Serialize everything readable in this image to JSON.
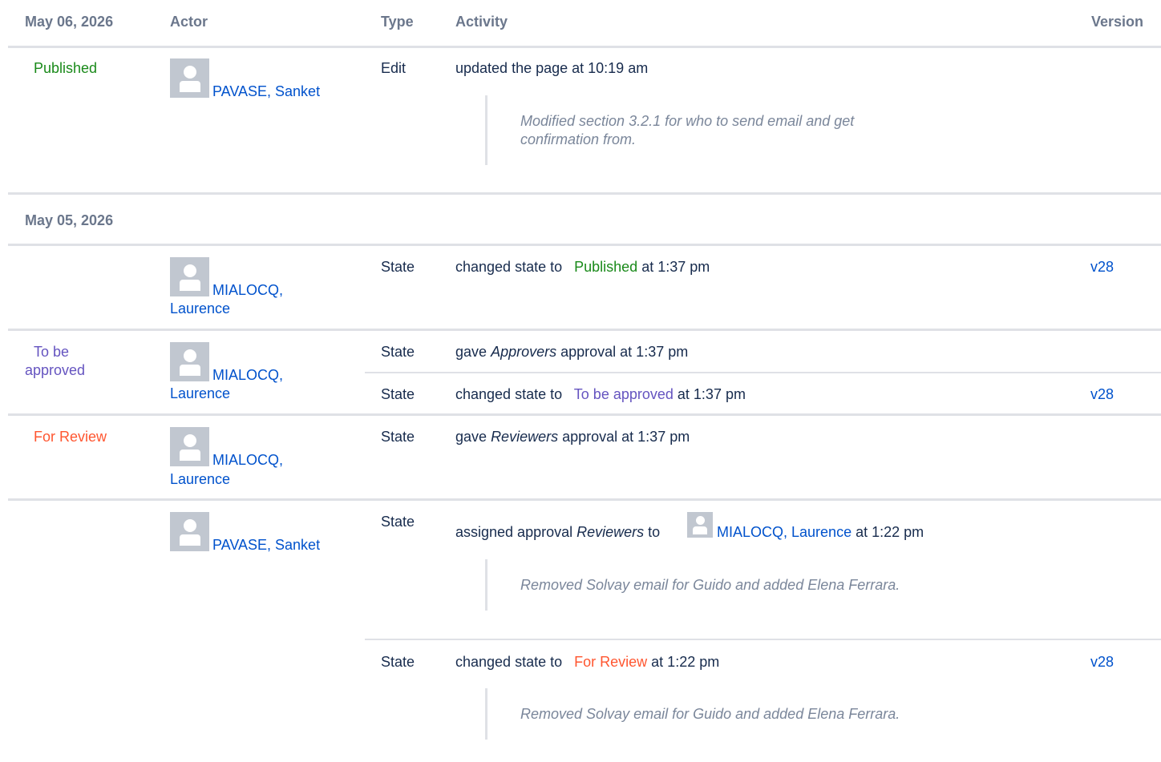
{
  "header": {
    "date": "May 06, 2026",
    "actor": "Actor",
    "type": "Type",
    "activity": "Activity",
    "version": "Version"
  },
  "second_date": "May 05, 2026",
  "colors": {
    "published": "#1a8a1a",
    "to_be_approved": "#6554c0",
    "for_review": "#ff5630",
    "link": "#0052cc",
    "muted": "#7a869a"
  },
  "row1": {
    "state": "Published",
    "actor": "PAVASE, Sanket",
    "type": "Edit",
    "activity": "updated the page at 10:19 am",
    "comment": "Modified section 3.2.1 for who to send email and get confirmation from."
  },
  "row2": {
    "actor_line1": "MIALOCQ,",
    "actor_line2": "Laurence",
    "type": "State",
    "prefix": "changed state to",
    "state": "Published",
    "suffix": "at 1:37 pm",
    "version": "v28"
  },
  "row3": {
    "state_line1": "To be",
    "state_line2": "approved",
    "actor_line1": "MIALOCQ,",
    "actor_line2": "Laurence",
    "a_type": "State",
    "a_prefix": "gave",
    "a_role": "Approvers",
    "a_suffix": "approval at 1:37 pm",
    "b_type": "State",
    "b_prefix": "changed state to",
    "b_state": "To be approved",
    "b_suffix": "at 1:37 pm",
    "b_version": "v28"
  },
  "row4": {
    "state": "For Review",
    "actor_line1": "MIALOCQ,",
    "actor_line2": "Laurence",
    "type": "State",
    "prefix": "gave",
    "role": "Reviewers",
    "suffix": "approval at 1:37 pm"
  },
  "row5": {
    "actor": "PAVASE, Sanket",
    "a_type": "State",
    "a_prefix": "assigned approval",
    "a_role": "Reviewers",
    "a_to": "to",
    "a_assignee": "MIALOCQ, Laurence",
    "a_suffix": "at 1:22 pm",
    "a_comment": "Removed Solvay email for Guido and added Elena Ferrara.",
    "b_type": "State",
    "b_prefix": "changed state to",
    "b_state": "For Review",
    "b_suffix": "at 1:22 pm",
    "b_version": "v28",
    "b_comment": "Removed Solvay email for Guido and added Elena Ferrara."
  }
}
